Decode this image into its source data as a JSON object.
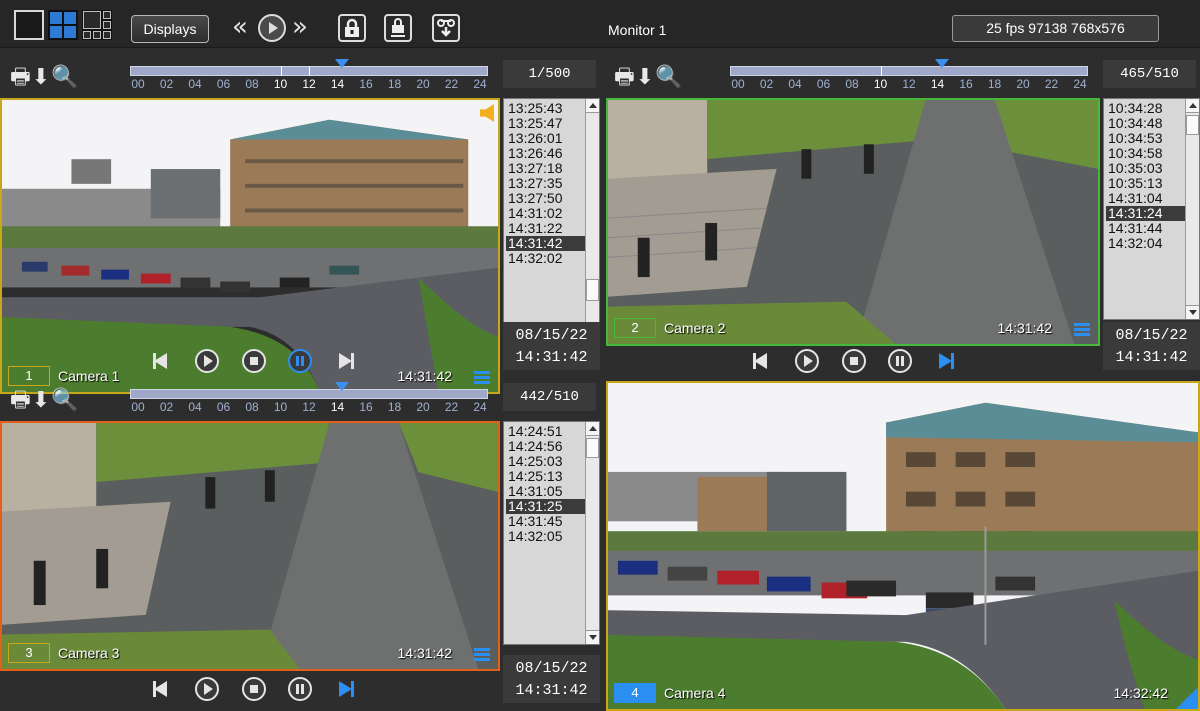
{
  "toolbar": {
    "displays_label": "Displays",
    "monitor_title": "Monitor 1",
    "status": "25 fps  97138 768x576",
    "rewind_glyph": "«",
    "forward_glyph": "»",
    "lock_glyph": "🔒",
    "eject_glyph": "⏏",
    "tape_glyph": "⏚"
  },
  "timeline_labels": [
    "00",
    "02",
    "04",
    "06",
    "08",
    "10",
    "12",
    "14",
    "16",
    "18",
    "20",
    "22",
    "24"
  ],
  "tool_glyphs": [
    "🖶",
    "⬇",
    "🔍"
  ],
  "panels": [
    {
      "counter": "1/500",
      "camera_number": "1",
      "camera_name": "Camera 1",
      "overlay_time": "14:31:42",
      "times": [
        "13:25:43",
        "13:25:47",
        "13:26:01",
        "13:26:46",
        "13:27:18",
        "13:27:35",
        "13:27:50",
        "14:31:02",
        "14:31:22",
        "14:31:42",
        "14:32:02"
      ],
      "selected_index": 9,
      "date": "08/15/22",
      "time": "14:31:42",
      "border_color": "#c9a71a",
      "highlighted_hours": [
        10,
        12,
        14
      ],
      "thumb_hour": 14.3
    },
    {
      "counter": "465/510",
      "camera_number": "2",
      "camera_name": "Camera 2",
      "overlay_time": "14:31:42",
      "times": [
        "10:34:28",
        "10:34:48",
        "10:34:53",
        "10:34:58",
        "10:35:03",
        "10:35:13",
        "14:31:04",
        "14:31:24",
        "14:31:44",
        "14:32:04"
      ],
      "selected_index": 7,
      "date": "08/15/22",
      "time": "14:31:42",
      "border_color": "#46b83a",
      "highlighted_hours": [
        10,
        14
      ],
      "thumb_hour": 14.3
    },
    {
      "counter": "442/510",
      "camera_number": "3",
      "camera_name": "Camera 3",
      "overlay_time": "14:31:42",
      "times": [
        "14:24:51",
        "14:24:56",
        "14:25:03",
        "14:25:13",
        "14:31:05",
        "14:31:25",
        "14:31:45",
        "14:32:05"
      ],
      "selected_index": 5,
      "date": "08/15/22",
      "time": "14:31:42",
      "border_color": "#e2601a",
      "highlighted_hours": [
        14
      ],
      "thumb_hour": 14.3
    },
    {
      "camera_number": "4",
      "camera_name": "Camera 4",
      "overlay_time": "14:32:42",
      "border_color": "#c9a71a"
    }
  ]
}
